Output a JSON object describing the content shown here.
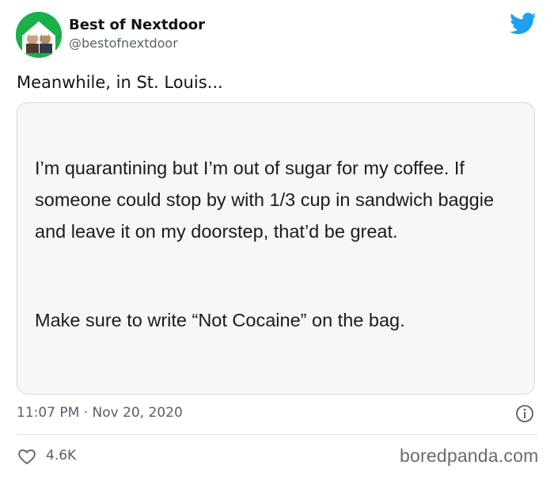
{
  "author": {
    "name": "Best of Nextdoor",
    "handle": "@bestofnextdoor",
    "avatar_icon": "nextdoor-house-avatar-icon"
  },
  "platform_icon": "twitter-bird-icon",
  "tweet": {
    "text": "Meanwhile, in St. Louis...",
    "card_paragraphs": [
      "I’m quarantining but I’m out of sugar for my coffee. If someone could stop by with 1/3 cup in sandwich baggie and leave it on my doorstep, that’d be great.",
      "Make sure to write “Not Cocaine” on the bag."
    ],
    "timestamp": "11:07 PM · Nov 20, 2020",
    "likes": "4.6K"
  },
  "watermark": "boredpanda.com",
  "colors": {
    "twitter_blue": "#1da1f2",
    "nextdoor_green": "#19b14a",
    "text_primary": "#0f1419",
    "text_secondary": "#586069"
  }
}
